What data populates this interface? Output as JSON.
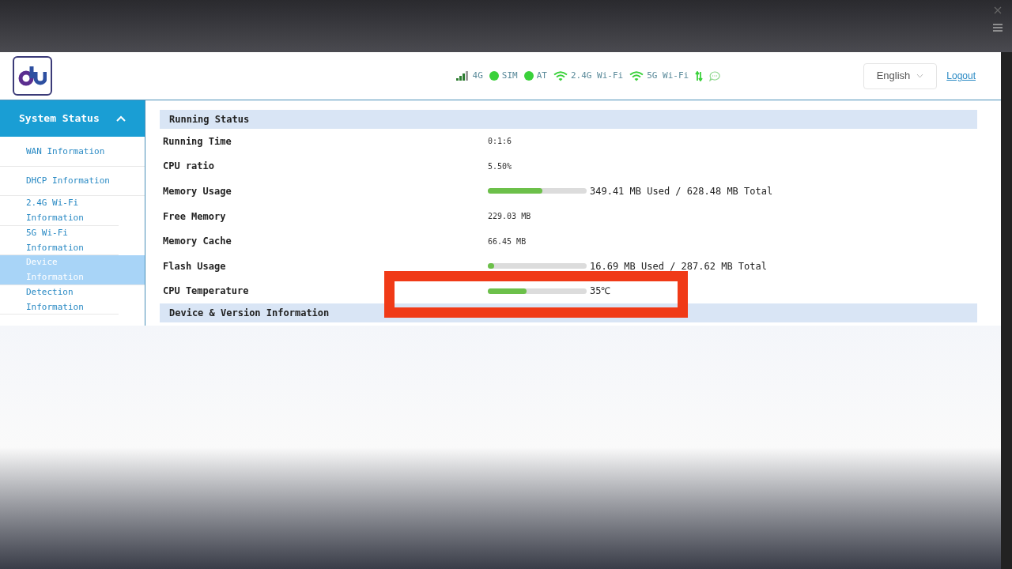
{
  "header": {
    "status": [
      {
        "kind": "signal",
        "label": "4G"
      },
      {
        "kind": "dot",
        "label": "SIM"
      },
      {
        "kind": "dot",
        "label": "AT"
      },
      {
        "kind": "wifi",
        "label": "2.4G Wi-Fi"
      },
      {
        "kind": "wifi",
        "label": "5G Wi-Fi"
      },
      {
        "kind": "transfer"
      },
      {
        "kind": "message"
      }
    ],
    "language": "English",
    "logout": "Logout"
  },
  "sidebar": {
    "title": "System Status",
    "expanded": true,
    "items": [
      {
        "label": "WAN Information",
        "selected": false
      },
      {
        "label": "DHCP Information",
        "selected": false
      },
      {
        "label": "2.4G Wi-Fi Information",
        "selected": false
      },
      {
        "label": "5G Wi-Fi Information",
        "selected": false
      },
      {
        "label": "Device Information",
        "selected": true
      },
      {
        "label": "Detection Information",
        "selected": false
      }
    ]
  },
  "sections": [
    {
      "title": "Running Status",
      "rows": [
        {
          "label": "Running Time",
          "value": "0:1:6"
        },
        {
          "label": "CPU ratio",
          "value": "5.50%"
        },
        {
          "label": "Memory Usage",
          "value": "349.41 MB Used / 628.48 MB Total",
          "level": 0.55
        },
        {
          "label": "Free Memory",
          "value": "229.03 MB"
        },
        {
          "label": "Memory Cache",
          "value": "66.45 MB"
        },
        {
          "label": "Flash Usage",
          "value": "16.69 MB Used / 287.62 MB Total",
          "level": 0.06
        },
        {
          "label": "CPU Temperature",
          "value": "35℃",
          "level": 0.39
        }
      ]
    },
    {
      "title": "Device & Version Information"
    }
  ]
}
